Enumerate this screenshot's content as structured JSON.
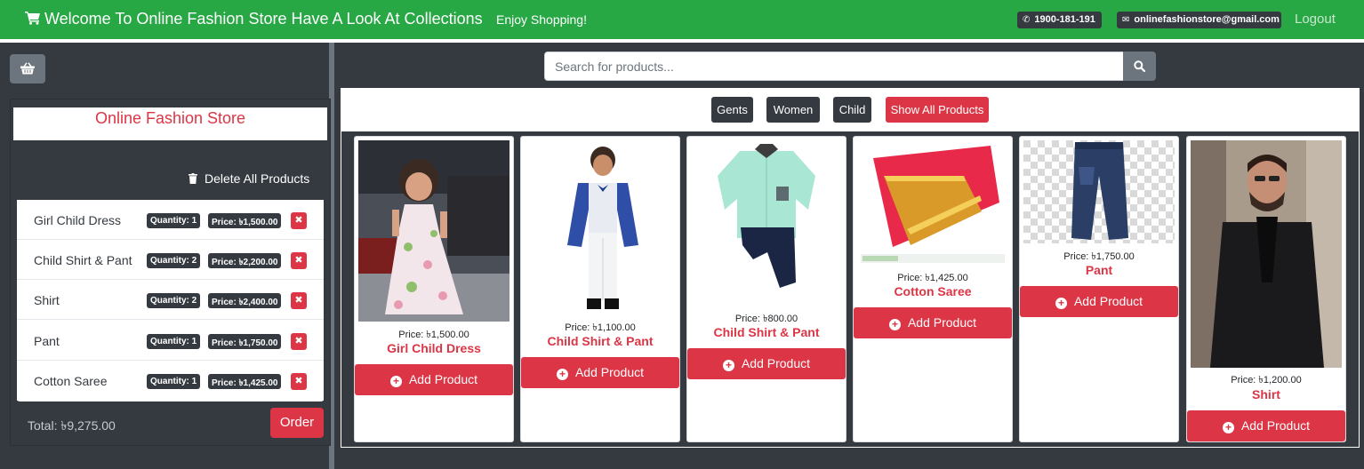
{
  "header": {
    "brand_icon": "shopping-cart-icon",
    "title": "Welcome To Online Fashion Store Have A Look At Collections",
    "tagline": "Enjoy Shopping!",
    "phone_icon": "phone-icon",
    "phone": "1900-181-191",
    "email_icon": "envelope-icon",
    "email": "onlinefashionstore@gmail.com",
    "logout": "Logout",
    "bar_color": "#28a745"
  },
  "sidebar": {
    "basket_icon": "basket-icon",
    "store_title": "Online Fashion Store",
    "delete_all": "Delete All Products",
    "items": [
      {
        "name": "Girl Child Dress",
        "qty": "Quantity: 1",
        "price": "Price: ৳1,500.00"
      },
      {
        "name": "Child Shirt & Pant",
        "qty": "Quantity: 2",
        "price": "Price: ৳2,200.00"
      },
      {
        "name": "Shirt",
        "qty": "Quantity: 2",
        "price": "Price: ৳2,400.00"
      },
      {
        "name": "Pant",
        "qty": "Quantity: 1",
        "price": "Price: ৳1,750.00"
      },
      {
        "name": "Cotton Saree",
        "qty": "Quantity: 1",
        "price": "Price: ৳1,425.00"
      }
    ],
    "remove_label": "✖",
    "total": "Total: ৳9,275.00",
    "order": "Order"
  },
  "search": {
    "placeholder": "Search for products...",
    "icon": "search-icon"
  },
  "filters": {
    "gents": "Gents",
    "women": "Women",
    "child": "Child",
    "all": "Show All Products"
  },
  "products": [
    {
      "name": "Girl Child Dress",
      "price": "Price: ৳1,500.00",
      "add": "Add Product"
    },
    {
      "name": "Child Shirt & Pant",
      "price": "Price: ৳1,100.00",
      "add": "Add Product"
    },
    {
      "name": "Child Shirt & Pant",
      "price": "Price: ৳800.00",
      "add": "Add Product"
    },
    {
      "name": "Cotton Saree",
      "price": "Price: ৳1,425.00",
      "add": "Add Product"
    },
    {
      "name": "Pant",
      "price": "Price: ৳1,750.00",
      "add": "Add Product"
    },
    {
      "name": "Shirt",
      "price": "Price: ৳1,200.00",
      "add": "Add Product"
    }
  ],
  "accent_color": "#dc3545"
}
